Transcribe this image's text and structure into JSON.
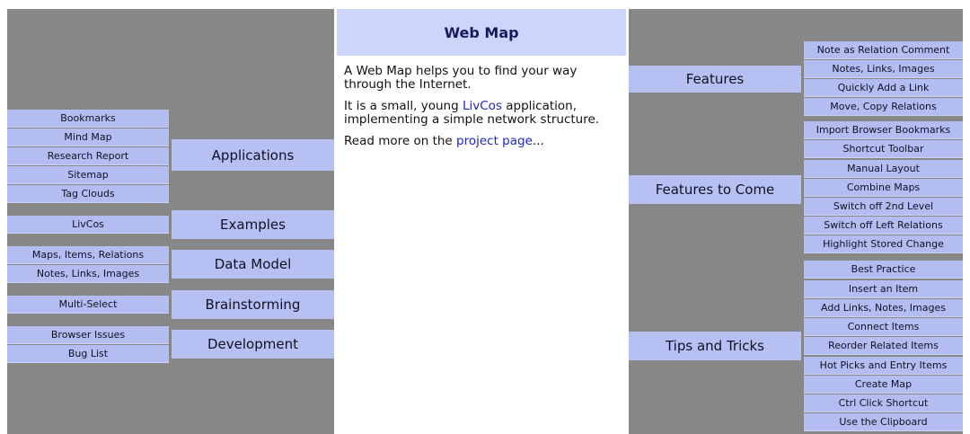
{
  "center": {
    "title": "Web Map",
    "p1": "A Web Map helps you to find your way through the Internet.",
    "p2_before": "It is a small, young ",
    "p2_link": "LivCos",
    "p2_after": " application, implementing a simple network structure.",
    "p3_before": "Read more on the ",
    "p3_link": "project page",
    "p3_after": "..."
  },
  "left": {
    "categories": [
      "Applications",
      "Examples",
      "Data Model",
      "Brainstorming",
      "Development"
    ],
    "items": [
      "Bookmarks",
      "Mind Map",
      "Research Report",
      "Sitemap",
      "Tag Clouds",
      "LivCos",
      "Maps, Items, Relations",
      "Notes, Links, Images",
      "Multi-Select",
      "Browser Issues",
      "Bug List"
    ]
  },
  "right": {
    "categories": [
      "Features",
      "Features to Come",
      "Tips and Tricks"
    ],
    "items": [
      "Note as Relation Comment",
      "Notes, Links, Images",
      "Quickly Add a Link",
      "Move, Copy Relations",
      "Import Browser Bookmarks",
      "Shortcut Toolbar",
      "Manual Layout",
      "Combine Maps",
      "Switch off 2nd Level",
      "Switch off Left Relations",
      "Highlight Stored Change",
      "Best Practice",
      "Insert an Item",
      "Add Links, Notes, Images",
      "Connect Items",
      "Reorder Related Items",
      "Hot Picks and Entry Items",
      "Create Map",
      "Ctrl Click Shortcut",
      "Use the Clipboard"
    ]
  },
  "colors": {
    "panel_gray": "#878787",
    "box_blue": "#b3bdf2",
    "title_band": "#ccd5fb",
    "link": "#2222cc"
  }
}
